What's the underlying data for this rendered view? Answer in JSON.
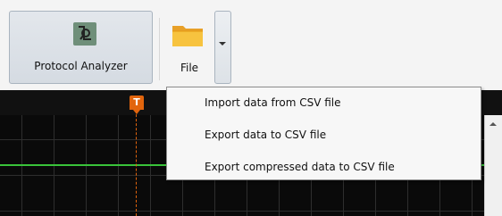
{
  "toolbar": {
    "protocol_analyzer_label": "Protocol Analyzer",
    "file_label": "File"
  },
  "timeline": {
    "trigger_marker_label": "T",
    "signal_color": "#39c33a",
    "marker_color": "#e2650d"
  },
  "file_menu": {
    "items": [
      {
        "label": "Import data from CSV file"
      },
      {
        "label": "Export data to CSV file"
      },
      {
        "label": "Export compressed data to CSV file"
      }
    ]
  },
  "icons": {
    "protocol_analyzer": "protocol-analyzer-icon",
    "file": "folder-icon",
    "dropdown": "chevron-down-icon",
    "scroll_up": "arrow-up-icon"
  }
}
